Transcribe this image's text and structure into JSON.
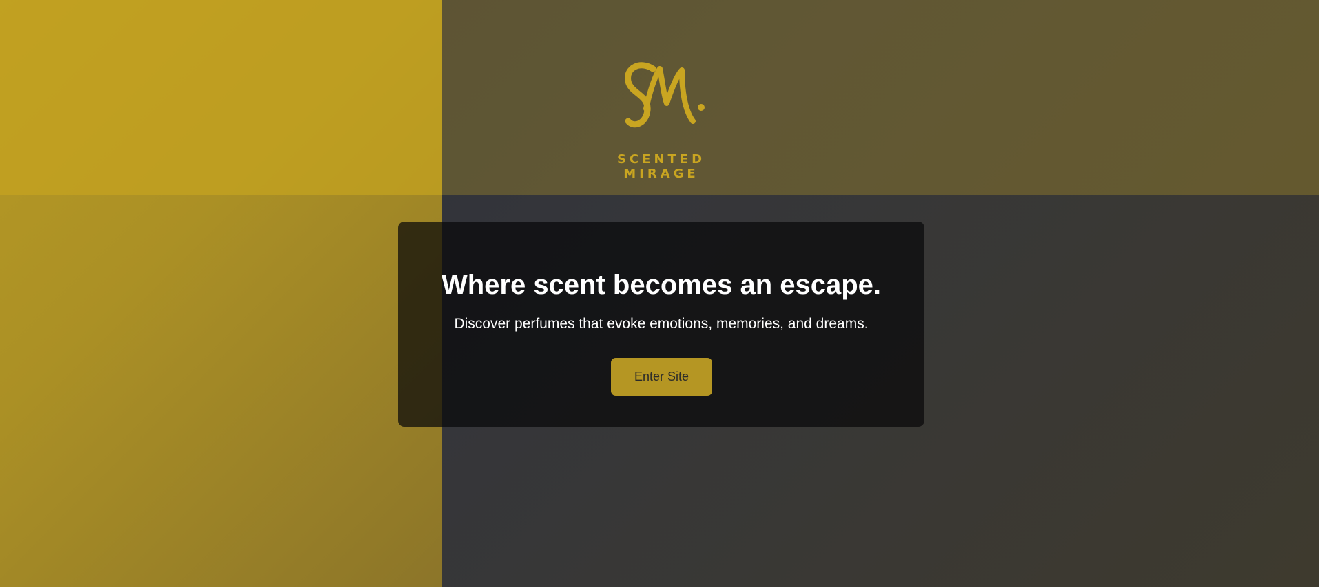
{
  "brand": {
    "monogram": "SM.",
    "wordmark": "SCENTED MIRAGE"
  },
  "hero": {
    "title": "Where scent becomes an escape.",
    "subtitle": "Discover perfumes that evoke emotions, memories, and dreams.",
    "cta_label": "Enter Site"
  },
  "colors": {
    "accent": "#b59623",
    "logo": "#c9a521",
    "card_bg": "#0b0b0d",
    "text": "#ffffff"
  }
}
